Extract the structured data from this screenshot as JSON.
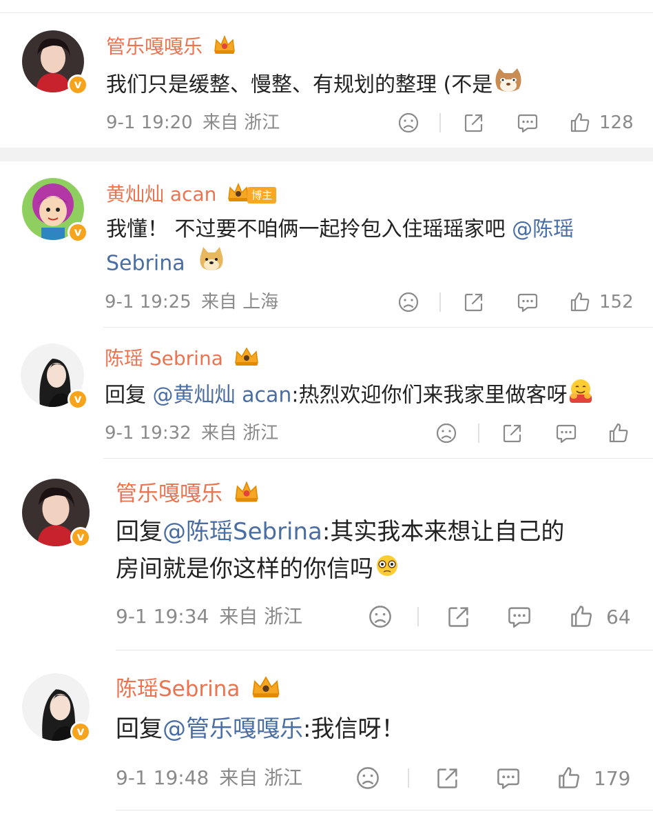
{
  "comments": [
    {
      "user": "管乐嘎嘎乐",
      "text": "我们只是缓整、慢整、有规划的整理 (不是",
      "time": "9-1 19:20",
      "location": "来自 浙江",
      "likes": "128",
      "verified_mark": "v"
    },
    {
      "user": "黄灿灿 acan",
      "badge": "博主",
      "text": "我懂！ 不过要不咱俩一起拎包入住瑶瑶家吧 ",
      "mention": "@陈瑶",
      "text_line2": "Sebrina",
      "time": "9-1 19:25",
      "location": "来自 上海",
      "likes": "152",
      "verified_mark": "v"
    },
    {
      "user": "陈瑶 Sebrina",
      "reply_prefix": "回复 ",
      "mention": "@黄灿灿 acan",
      "text": ":热烈欢迎你们来我家里做客呀",
      "time": "9-1 19:32",
      "location": "来自 浙江",
      "likes": "",
      "verified_mark": "v"
    },
    {
      "user": "管乐嘎嘎乐",
      "reply_prefix": "回复",
      "mention": "@陈瑶Sebrina",
      "text": ":其实我本来想让自己的",
      "text_line2": "房间就是你这样的你信吗",
      "time": "9-1 19:34",
      "location": "来自 浙江",
      "likes": "64",
      "verified_mark": "v"
    },
    {
      "user": "陈瑶Sebrina",
      "reply_prefix": "回复",
      "mention": "@管乐嘎嘎乐",
      "text": ":我信呀！",
      "time": "9-1 19:48",
      "location": "来自 浙江",
      "likes": "179",
      "verified_mark": "v"
    }
  ],
  "icons": [
    "dislike-icon",
    "share-icon",
    "comment-icon",
    "like-icon",
    "crown-icon",
    "cat-emoji",
    "doge-emoji",
    "hug-emoji",
    "nervous-emoji"
  ],
  "colors": {
    "username": "#eb7350",
    "mention": "#4a6ea3",
    "meta": "#8a8a8a",
    "badge": "#f9a825"
  }
}
